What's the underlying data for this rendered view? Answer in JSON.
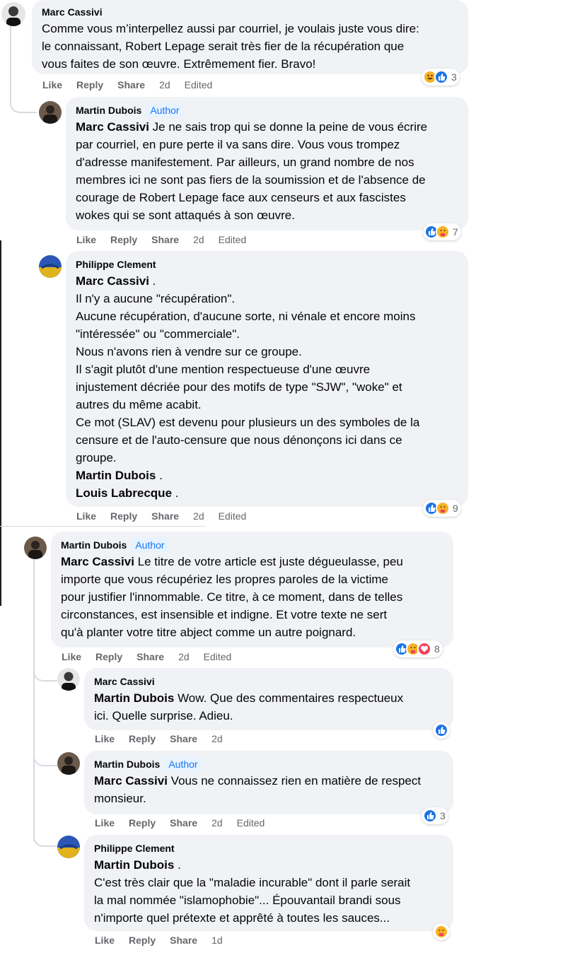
{
  "comments": [
    {
      "author": "Marc Cassivi",
      "badge": "",
      "mention": "",
      "text": "Comme vous m’interpellez aussi par courriel, je voulais juste vous dire:\nle connaissant, Robert Lepage serait très fier de la récupération que\nvous faites de son œuvre. Extrêmement fier. Bravo!",
      "actions": {
        "like": "Like",
        "reply": "Reply",
        "share": "Share",
        "time": "2d",
        "edited": "Edited"
      },
      "reaction_count": "3",
      "reactions": [
        "haha-icon",
        "like-icon"
      ]
    },
    {
      "author": "Martin Dubois",
      "badge": "Author",
      "mention": "Marc Cassivi",
      "text": " Je ne sais trop qui se donne la peine de vous écrire\npar courriel, en pure perte il va sans dire. Vous vous trompez\nd'adresse manifestement. Par ailleurs, un grand nombre de nos\nmembres ici ne sont pas fiers de la soumission et de l'absence de\ncourage de Robert Lepage face aux censeurs et aux fascistes\nwokes qui se sont attaqués à son œuvre.",
      "actions": {
        "like": "Like",
        "reply": "Reply",
        "share": "Share",
        "time": "2d",
        "edited": "Edited"
      },
      "reaction_count": "7",
      "reactions": [
        "like-icon",
        "care-icon"
      ]
    },
    {
      "author": "Philippe Clement",
      "badge": "",
      "mention": "Marc Cassivi",
      "text_after_mention": " .",
      "text": "Il n'y a aucune \"récupération\".\nAucune récupération, d'aucune sorte, ni vénale et encore moins\n\"intéressée\" ou \"commerciale\".\nNous n'avons rien à vendre sur ce groupe.\nIl s'agit plutôt d'une mention respectueuse d'une œuvre\ninjustement décriée pour des motifs de type \"SJW\", \"woke\" et\nautres du même acabit.\nCe mot (SLAV) est devenu pour plusieurs un des symboles de la\ncensure et de l'auto-censure que nous dénonçons ici dans ce\ngroupe.",
      "mention2": "Martin Dubois",
      "mention2_after": " .",
      "mention3": "Louis Labrecque",
      "mention3_after": " .",
      "actions": {
        "like": "Like",
        "reply": "Reply",
        "share": "Share",
        "time": "2d",
        "edited": "Edited"
      },
      "reaction_count": "9",
      "reactions": [
        "like-icon",
        "care-icon"
      ]
    },
    {
      "author": "Martin Dubois",
      "badge": "Author",
      "mention": "Marc Cassivi",
      "text": " Le titre de votre article est juste dégueulasse, peu\nimporte que vous récupériez les propres paroles de la victime\npour justifier l'innommable. Ce titre, à ce moment, dans de telles\ncirconstances, est insensible et indigne. Et votre texte ne sert\nqu'à planter votre titre abject comme un autre poignard.",
      "actions": {
        "like": "Like",
        "reply": "Reply",
        "share": "Share",
        "time": "2d",
        "edited": "Edited"
      },
      "reaction_count": "8",
      "reactions": [
        "like-icon",
        "care-icon",
        "love-icon"
      ]
    },
    {
      "author": "Marc Cassivi",
      "badge": "",
      "mention": "Martin Dubois",
      "text": " Wow. Que des commentaires respectueux\nici. Quelle surprise. Adieu.",
      "actions": {
        "like": "Like",
        "reply": "Reply",
        "share": "Share",
        "time": "2d",
        "edited": ""
      },
      "reaction_count": "",
      "reactions": [
        "like-icon"
      ]
    },
    {
      "author": "Martin Dubois",
      "badge": "Author",
      "mention": "Marc Cassivi",
      "text": " Vous ne connaissez rien en matière de respect\nmonsieur.",
      "actions": {
        "like": "Like",
        "reply": "Reply",
        "share": "Share",
        "time": "2d",
        "edited": "Edited"
      },
      "reaction_count": "3",
      "reactions": [
        "like-icon"
      ]
    },
    {
      "author": "Philippe Clement",
      "badge": "",
      "mention": "Martin Dubois",
      "mention_after": " .",
      "text": "C'est très clair que la \"maladie incurable\" dont il parle serait\nla mal nommée \"islamophobie\"... Épouvantail brandi sous\nn'importe quel prétexte et apprêté à toutes les sauces...",
      "actions": {
        "like": "Like",
        "reply": "Reply",
        "share": "Share",
        "time": "1d",
        "edited": ""
      },
      "reaction_count": "",
      "reactions": [
        "care-icon"
      ]
    }
  ],
  "colors": {
    "bubble": "#f0f2f5",
    "like": "#1b74e4",
    "love": "#f33e58",
    "care": "#f7b125",
    "author_badge_bg": "#e7f3ff",
    "author_badge_text": "#1876f2",
    "meta_text": "#65676b"
  }
}
